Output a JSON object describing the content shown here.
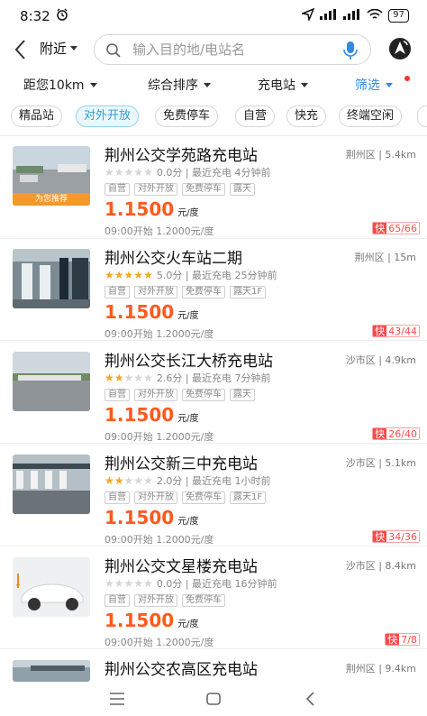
{
  "status_bar": {
    "time": "8:32",
    "battery": "97"
  },
  "header": {
    "location_label": "附近",
    "search_placeholder": "输入目的地/电站名"
  },
  "filters": [
    {
      "label": "距您10km"
    },
    {
      "label": "综合排序"
    },
    {
      "label": "充电站"
    },
    {
      "label": "筛选"
    }
  ],
  "chips": [
    {
      "label": "精品站",
      "active": false
    },
    {
      "label": "对外开放",
      "active": true
    },
    {
      "label": "免费停车",
      "active": false
    },
    {
      "label": "自营",
      "active": false
    },
    {
      "label": "快充",
      "active": false
    },
    {
      "label": "终端空闲",
      "active": false
    }
  ],
  "stations": [
    {
      "name": "荆州公交学苑路充电站",
      "district": "荆州区 | 5.4km",
      "stars": 0,
      "rating_text": "0.0分 | 最近充电 4分钟前",
      "tags": [
        "自营",
        "对外开放",
        "免费停车",
        "露天"
      ],
      "price": "1.1500",
      "price_unit": "元/度",
      "sub_price": "09:00开始 1.2000元/度",
      "fast_label": "快",
      "fast_count": "65/66",
      "recommend": "为您推荐"
    },
    {
      "name": "荆州公交火车站二期",
      "district": "荆州区 | 15m",
      "stars": 5,
      "rating_text": "5.0分 | 最近充电 25分钟前",
      "tags": [
        "自营",
        "对外开放",
        "免费停车",
        "露天1F"
      ],
      "price": "1.1500",
      "price_unit": "元/度",
      "sub_price": "09:00开始 1.2000元/度",
      "fast_label": "快",
      "fast_count": "43/44"
    },
    {
      "name": "荆州公交长江大桥充电站",
      "district": "沙市区 | 4.9km",
      "stars": 2.6,
      "rating_text": "2.6分 | 最近充电 7分钟前",
      "tags": [
        "自营",
        "对外开放",
        "免费停车",
        "露天"
      ],
      "price": "1.1500",
      "price_unit": "元/度",
      "sub_price": "09:00开始 1.2000元/度",
      "fast_label": "快",
      "fast_count": "26/40"
    },
    {
      "name": "荆州公交新三中充电站",
      "district": "沙市区 | 5.1km",
      "stars": 2,
      "rating_text": "2.0分 | 最近充电 1小时前",
      "tags": [
        "自营",
        "对外开放",
        "免费停车",
        "露天1F"
      ],
      "price": "1.1500",
      "price_unit": "元/度",
      "sub_price": "09:00开始 1.2000元/度",
      "fast_label": "快",
      "fast_count": "34/36"
    },
    {
      "name": "荆州公交文星楼充电站",
      "district": "沙市区 | 8.4km",
      "stars": 0,
      "rating_text": "0.0分 | 最近充电 16分钟前",
      "tags": [
        "自营",
        "对外开放",
        "免费停车"
      ],
      "price": "1.1500",
      "price_unit": "元/度",
      "sub_price": "09:00开始 1.2000元/度",
      "fast_label": "快",
      "fast_count": "7/8"
    },
    {
      "name": "荆州公交农高区充电站",
      "district": "荆州区 | 9.4km"
    }
  ],
  "colors": {
    "accent_blue": "#2f8be6",
    "price_orange": "#ff5a1f",
    "fast_red": "#ff4b4b",
    "star": "#f5a623",
    "recommend_bg": "#f39a2a"
  }
}
